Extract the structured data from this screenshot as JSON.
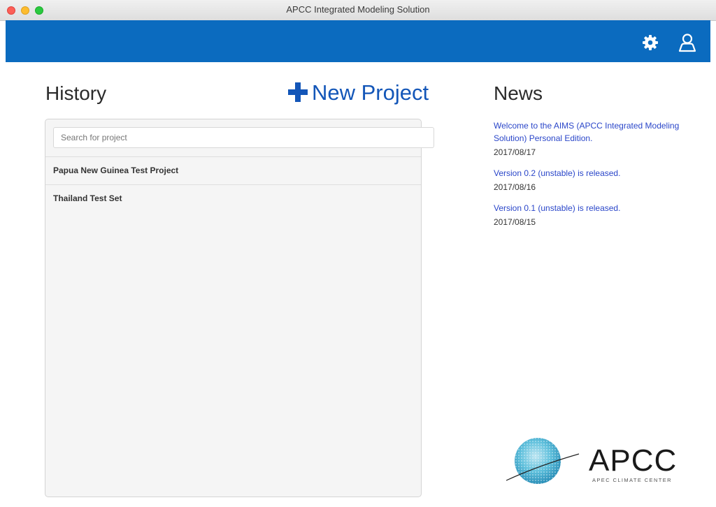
{
  "window": {
    "title": "APCC Integrated Modeling Solution"
  },
  "header": {
    "settings_icon": "gear-icon",
    "user_icon": "user-icon",
    "accent": "#0b6bbf"
  },
  "history": {
    "heading": "History",
    "new_project_label": "New Project",
    "search_placeholder": "Search for project",
    "projects": [
      {
        "name": "Papua New Guinea Test Project"
      },
      {
        "name": "Thailand Test Set"
      }
    ]
  },
  "news": {
    "heading": "News",
    "items": [
      {
        "title": "Welcome to the AIMS (APCC Integrated Modeling Solution) Personal Edition.",
        "date": "2017/08/17"
      },
      {
        "title": "Version 0.2 (unstable) is released.",
        "date": "2017/08/16"
      },
      {
        "title": "Version 0.1 (unstable) is released.",
        "date": "2017/08/15"
      }
    ]
  },
  "logo": {
    "name": "APCC",
    "subtitle": "APEC CLIMATE CENTER"
  }
}
